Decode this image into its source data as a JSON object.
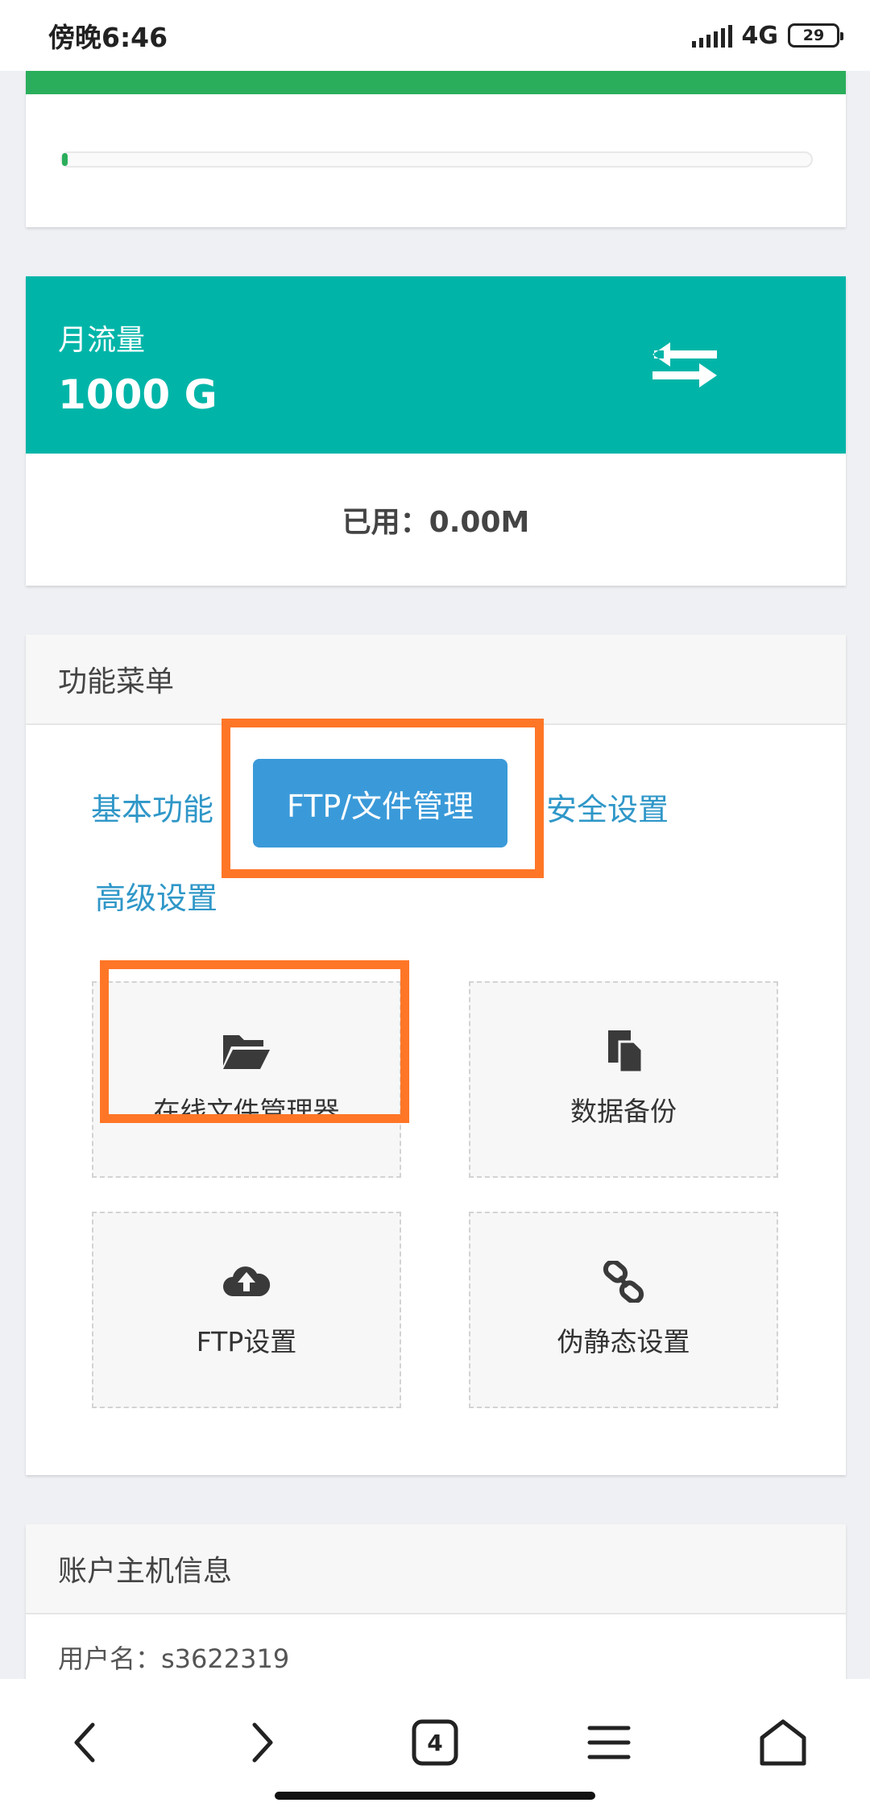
{
  "status_bar": {
    "time": "傍晚6:46",
    "network": "4G",
    "battery": "29"
  },
  "top_card": {
    "progress_fraction": 0.008
  },
  "traffic": {
    "label": "月流量",
    "value": "1000 G",
    "used": "已用：0.00M",
    "accent_color": "#00b5a8"
  },
  "menu": {
    "title": "功能菜单",
    "tabs": [
      {
        "label": "基本功能"
      },
      {
        "label": "FTP/文件管理"
      },
      {
        "label": "安全设置"
      },
      {
        "label": "高级设置"
      }
    ],
    "tiles": [
      {
        "label": "在线文件管理器",
        "icon": "folder-open-icon"
      },
      {
        "label": "数据备份",
        "icon": "file-copy-icon"
      },
      {
        "label": "FTP设置",
        "icon": "cloud-upload-icon"
      },
      {
        "label": "伪静态设置",
        "icon": "link-icon"
      }
    ],
    "highlight_color": "#ff7627"
  },
  "account": {
    "title": "账户主机信息",
    "username": "用户名：s3622319"
  },
  "nav": {
    "tab_count": "4",
    "icons": [
      "back-icon",
      "forward-icon",
      "tabs-icon",
      "menu-icon",
      "home-icon"
    ]
  }
}
